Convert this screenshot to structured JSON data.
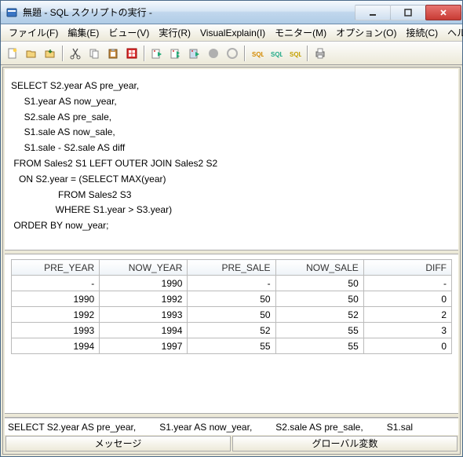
{
  "titlebar": {
    "text": "無題 - SQL スクリプトの実行 - "
  },
  "menus": {
    "file": "ファイル(F)",
    "edit": "編集(E)",
    "view": "ビュー(V)",
    "run": "実行(R)",
    "visualexplain": "VisualExplain(I)",
    "monitor": "モニター(M)",
    "options": "オプション(O)",
    "connect": "接続(C)",
    "help": "ヘルプ(H)"
  },
  "editor_text": "SELECT S2.year AS pre_year,\n     S1.year AS now_year,\n     S2.sale AS pre_sale,\n     S1.sale AS now_sale,\n     S1.sale - S2.sale AS diff\n FROM Sales2 S1 LEFT OUTER JOIN Sales2 S2\n   ON S2.year = (SELECT MAX(year)\n                  FROM Sales2 S3\n                 WHERE S1.year > S3.year)\n ORDER BY now_year;",
  "grid": {
    "columns": [
      "PRE_YEAR",
      "NOW_YEAR",
      "PRE_SALE",
      "NOW_SALE",
      "DIFF"
    ],
    "rows": [
      [
        "-",
        "1990",
        "-",
        "50",
        "-"
      ],
      [
        "1990",
        "1992",
        "50",
        "50",
        "0"
      ],
      [
        "1992",
        "1993",
        "50",
        "52",
        "2"
      ],
      [
        "1993",
        "1994",
        "52",
        "55",
        "3"
      ],
      [
        "1994",
        "1997",
        "55",
        "55",
        "0"
      ]
    ]
  },
  "status_parts": [
    "SELECT S2.year AS pre_year,",
    "S1.year AS now_year,",
    "S2.sale AS pre_sale,",
    "S1.sal"
  ],
  "bottom": {
    "left": "メッセージ",
    "right": "グローバル変数"
  },
  "icons": {
    "new": "new-icon",
    "open": "open-icon",
    "save": "save-icon",
    "cut": "cut-icon",
    "copy": "copy-icon",
    "paste": "paste-icon",
    "crossref": "crossref-icon",
    "run": "run-icon",
    "runall": "runall-icon",
    "runsel": "runsel-icon",
    "stop": "stop-icon",
    "stopgrey": "stopgrey-icon",
    "sql1": "sql1-icon",
    "sql2": "sql2-icon",
    "sql3": "sql3-icon",
    "print": "print-icon"
  }
}
